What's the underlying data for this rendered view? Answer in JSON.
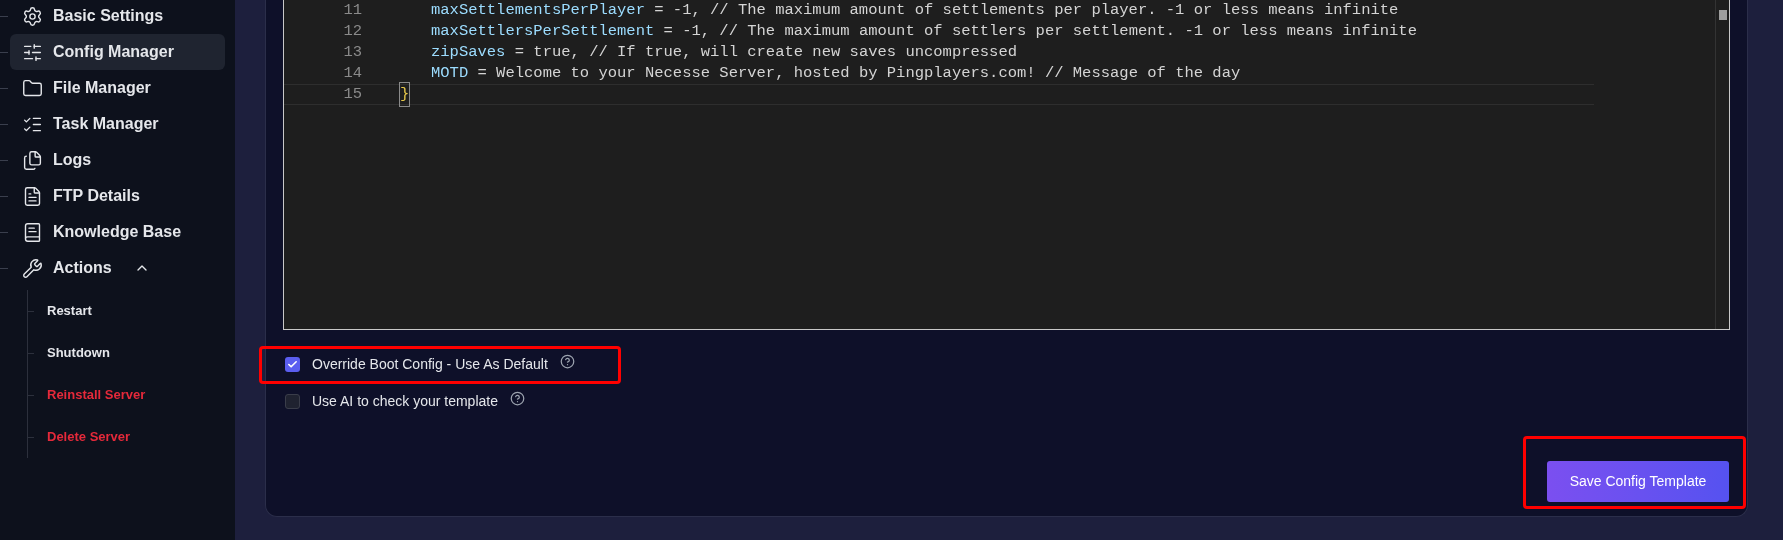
{
  "sidebar": {
    "items": [
      {
        "label": "Basic Settings",
        "selected": false
      },
      {
        "label": "Config Manager",
        "selected": true
      },
      {
        "label": "File Manager",
        "selected": false
      },
      {
        "label": "Task Manager",
        "selected": false
      },
      {
        "label": "Logs",
        "selected": false
      },
      {
        "label": "FTP Details",
        "selected": false
      },
      {
        "label": "Knowledge Base",
        "selected": false
      },
      {
        "label": "Actions",
        "selected": false,
        "expanded": true,
        "children": [
          {
            "label": "Restart",
            "danger": false
          },
          {
            "label": "Shutdown",
            "danger": false
          },
          {
            "label": "Reinstall Server",
            "danger": true
          },
          {
            "label": "Delete Server",
            "danger": true
          }
        ]
      }
    ]
  },
  "editor": {
    "lines": [
      {
        "number": "11",
        "key": "maxSettlementsPerPlayer",
        "rest": " = -1, // The maximum amount of settlements per player. -1 or less means infinite",
        "current": false
      },
      {
        "number": "12",
        "key": "maxSettlersPerSettlement",
        "rest": " = -1, // The maximum amount of settlers per settlement. -1 or less means infinite",
        "current": false
      },
      {
        "number": "13",
        "key": "zipSaves",
        "rest": " = true, // If true, will create new saves uncompressed",
        "current": false
      },
      {
        "number": "14",
        "key": "MOTD",
        "rest": " = Welcome to your Necesse Server, hosted by Pingplayers.com! // Message of the day",
        "current": false
      },
      {
        "number": "15",
        "bracket": "}",
        "current": true
      }
    ]
  },
  "options": [
    {
      "label": "Override Boot Config - Use As Default",
      "checked": true,
      "highlighted": true
    },
    {
      "label": "Use AI to check your template",
      "checked": false,
      "highlighted": false
    }
  ],
  "save_button": {
    "label": "Save Config Template",
    "highlighted": true
  }
}
